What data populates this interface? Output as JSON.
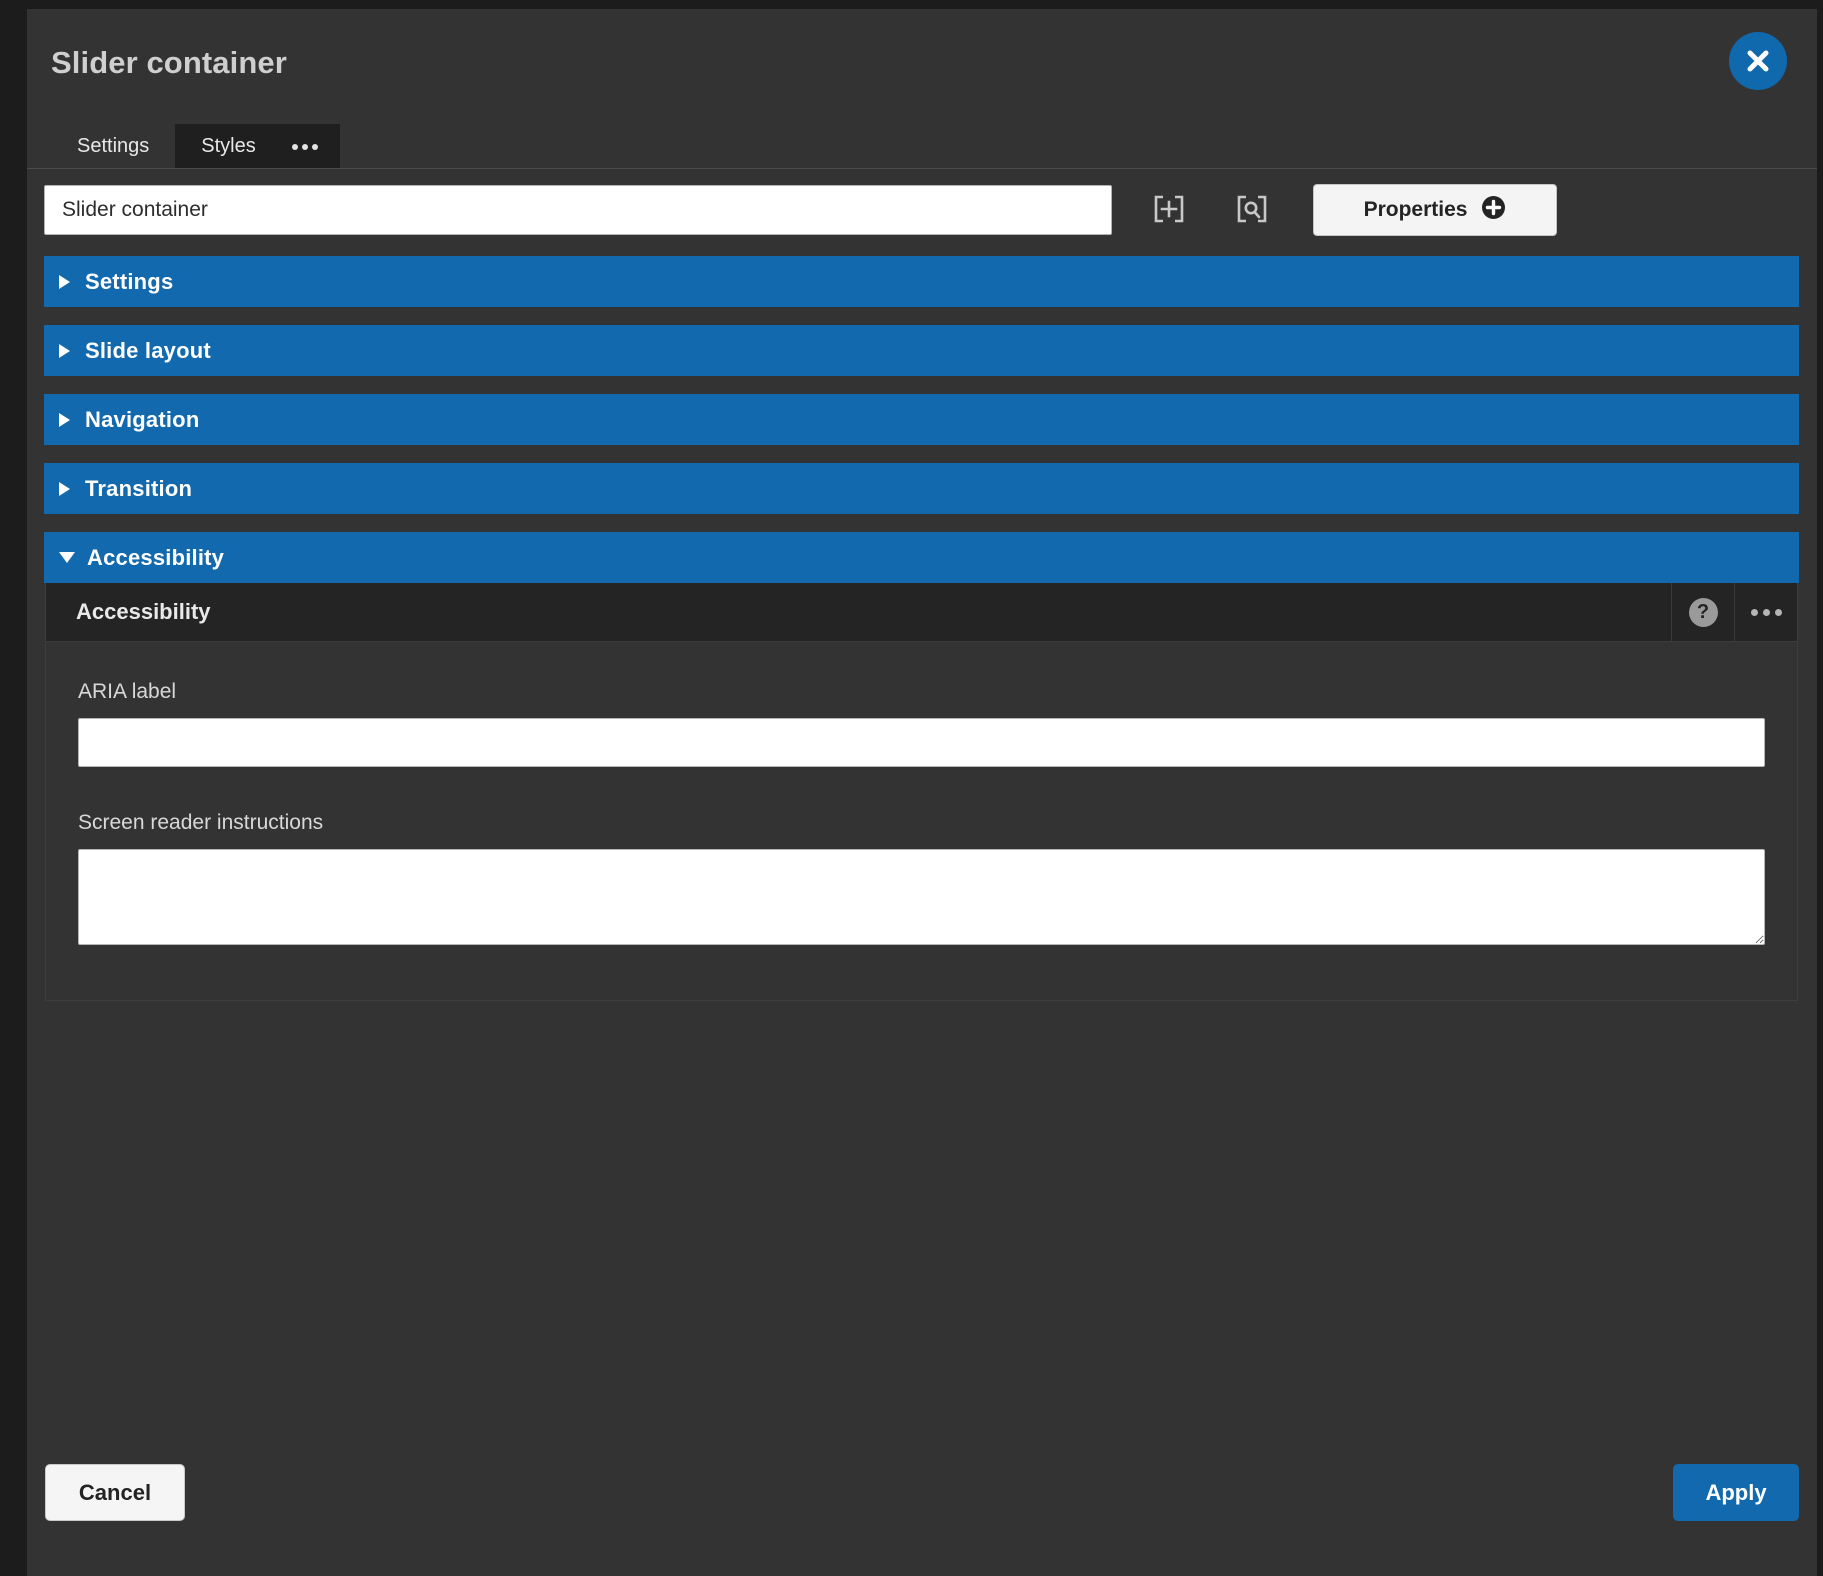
{
  "dialog": {
    "title": "Slider container",
    "close_icon": "close-x-icon"
  },
  "tabs": [
    {
      "label": "Settings",
      "active": true
    },
    {
      "label": "Styles",
      "active": false
    }
  ],
  "tabs_overflow_icon": "ellipsis-icon",
  "toolbar": {
    "name_value": "Slider container",
    "name_placeholder": "",
    "add_icon": "bracket-plus-icon",
    "find_icon": "bracket-search-icon",
    "properties_label": "Properties",
    "properties_icon": "plus-circle-icon"
  },
  "sections": [
    {
      "title": "Settings",
      "expanded": false,
      "caret_icon": "caret-right-icon"
    },
    {
      "title": "Slide layout",
      "expanded": false,
      "caret_icon": "caret-right-icon"
    },
    {
      "title": "Navigation",
      "expanded": false,
      "caret_icon": "caret-right-icon"
    },
    {
      "title": "Transition",
      "expanded": false,
      "caret_icon": "caret-right-icon"
    },
    {
      "title": "Accessibility",
      "expanded": true,
      "caret_icon": "caret-down-icon"
    }
  ],
  "accessibility_panel": {
    "header_title": "Accessibility",
    "help_icon": "question-mark-icon",
    "more_icon": "ellipsis-icon",
    "fields": [
      {
        "label": "ARIA label",
        "type": "text",
        "value": "",
        "placeholder": ""
      },
      {
        "label": "Screen reader instructions",
        "type": "textarea",
        "value": "",
        "placeholder": ""
      }
    ]
  },
  "footer": {
    "cancel_label": "Cancel",
    "apply_label": "Apply"
  },
  "colors": {
    "accent_blue": "#1269ad",
    "panel_bg": "#333333",
    "panel_dark": "#1f1f1f",
    "inner_header": "#242424"
  }
}
